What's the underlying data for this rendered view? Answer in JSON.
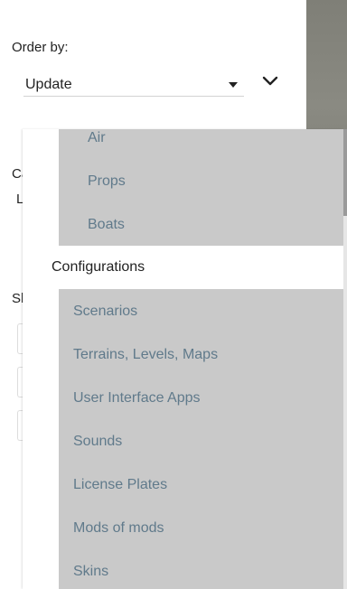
{
  "order_by": {
    "label": "Order by:",
    "selected": "Update"
  },
  "background_fragments": {
    "c_label": "Ca",
    "l_value": "L",
    "s_label": "Sh"
  },
  "dropdown": {
    "subitems": [
      "Air",
      "Props",
      "Boats"
    ],
    "active": "Configurations",
    "items": [
      "Scenarios",
      "Terrains, Levels, Maps",
      "User Interface Apps",
      "Sounds",
      "License Plates",
      "Mods of mods",
      "Skins"
    ]
  },
  "colors": {
    "highlight_bg": "#c9c9c9",
    "item_text": "#607a8b",
    "active_text": "#222222"
  }
}
